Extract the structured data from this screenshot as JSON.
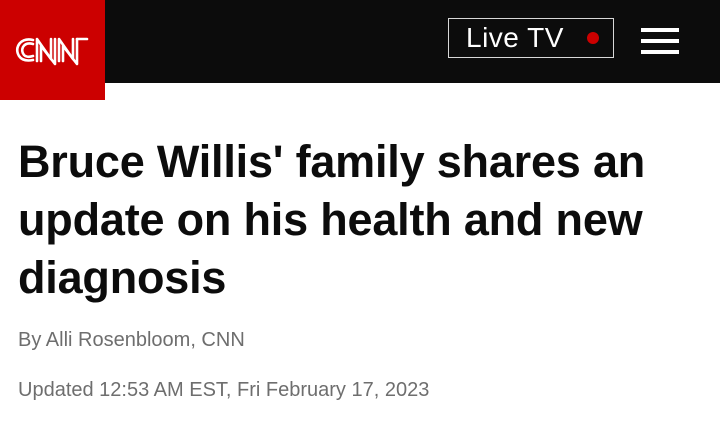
{
  "header": {
    "logo_text": "CNN",
    "live_tv_label": "Live TV",
    "colors": {
      "header_bg": "#0c0c0c",
      "brand_red": "#cc0000",
      "live_dot": "#cc0000"
    },
    "icons": {
      "logo": "cnn-logo",
      "menu": "hamburger-menu-icon",
      "live": "live-dot-icon"
    }
  },
  "article": {
    "headline": "Bruce Willis' family shares an update on his health and new diagnosis",
    "byline_prefix": "By ",
    "author": "Alli Rosenbloom",
    "byline_suffix": ", CNN",
    "timestamp": "Updated 12:53 AM EST, Fri February 17, 2023"
  }
}
